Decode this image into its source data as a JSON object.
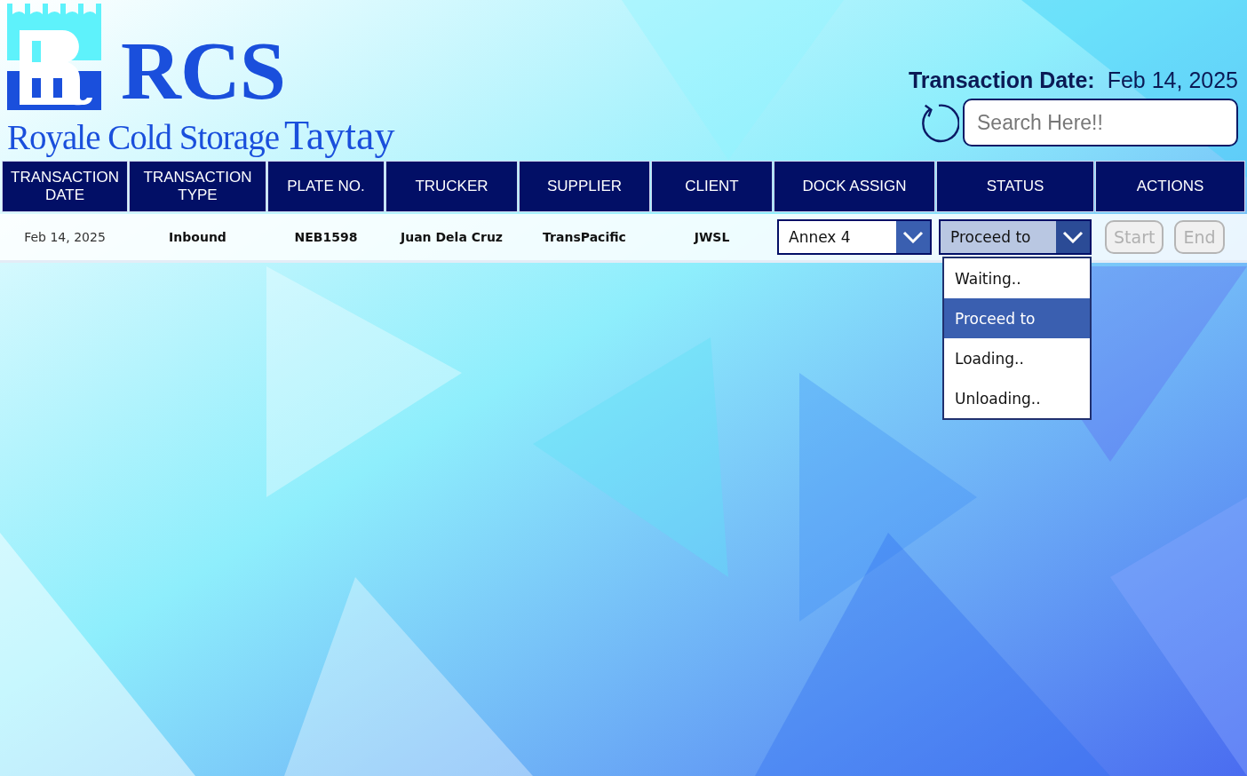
{
  "header": {
    "logo_title": "RCS",
    "logo_subtitle": "Royale Cold Storage",
    "branch": "Taytay",
    "transaction_date_label": "Transaction Date:",
    "transaction_date": "Feb 14, 2025",
    "search": {
      "placeholder": "Search Here!!"
    }
  },
  "table": {
    "columns": [
      "TRANSACTION DATE",
      "TRANSACTION TYPE",
      "PLATE NO.",
      "TRUCKER",
      "SUPPLIER",
      "CLIENT",
      "DOCK ASSIGN",
      "STATUS",
      "ACTIONS"
    ],
    "rows": [
      {
        "cells": [
          "Feb 14, 2025",
          "Inbound",
          "NEB1598",
          "Juan Dela Cruz",
          "TransPacific",
          "JWSL"
        ],
        "dock_assign": {
          "value": "Annex 4"
        },
        "status": {
          "value": "Proceed to",
          "expanded": true,
          "options": [
            {
              "label": "Waiting..",
              "selected": false
            },
            {
              "label": "Proceed to",
              "selected": true
            },
            {
              "label": "Loading..",
              "selected": false
            },
            {
              "label": "Unloading..",
              "selected": false
            }
          ]
        },
        "actions": [
          {
            "label": "Start",
            "disabled": true
          },
          {
            "label": "End",
            "disabled": true
          }
        ]
      }
    ]
  }
}
